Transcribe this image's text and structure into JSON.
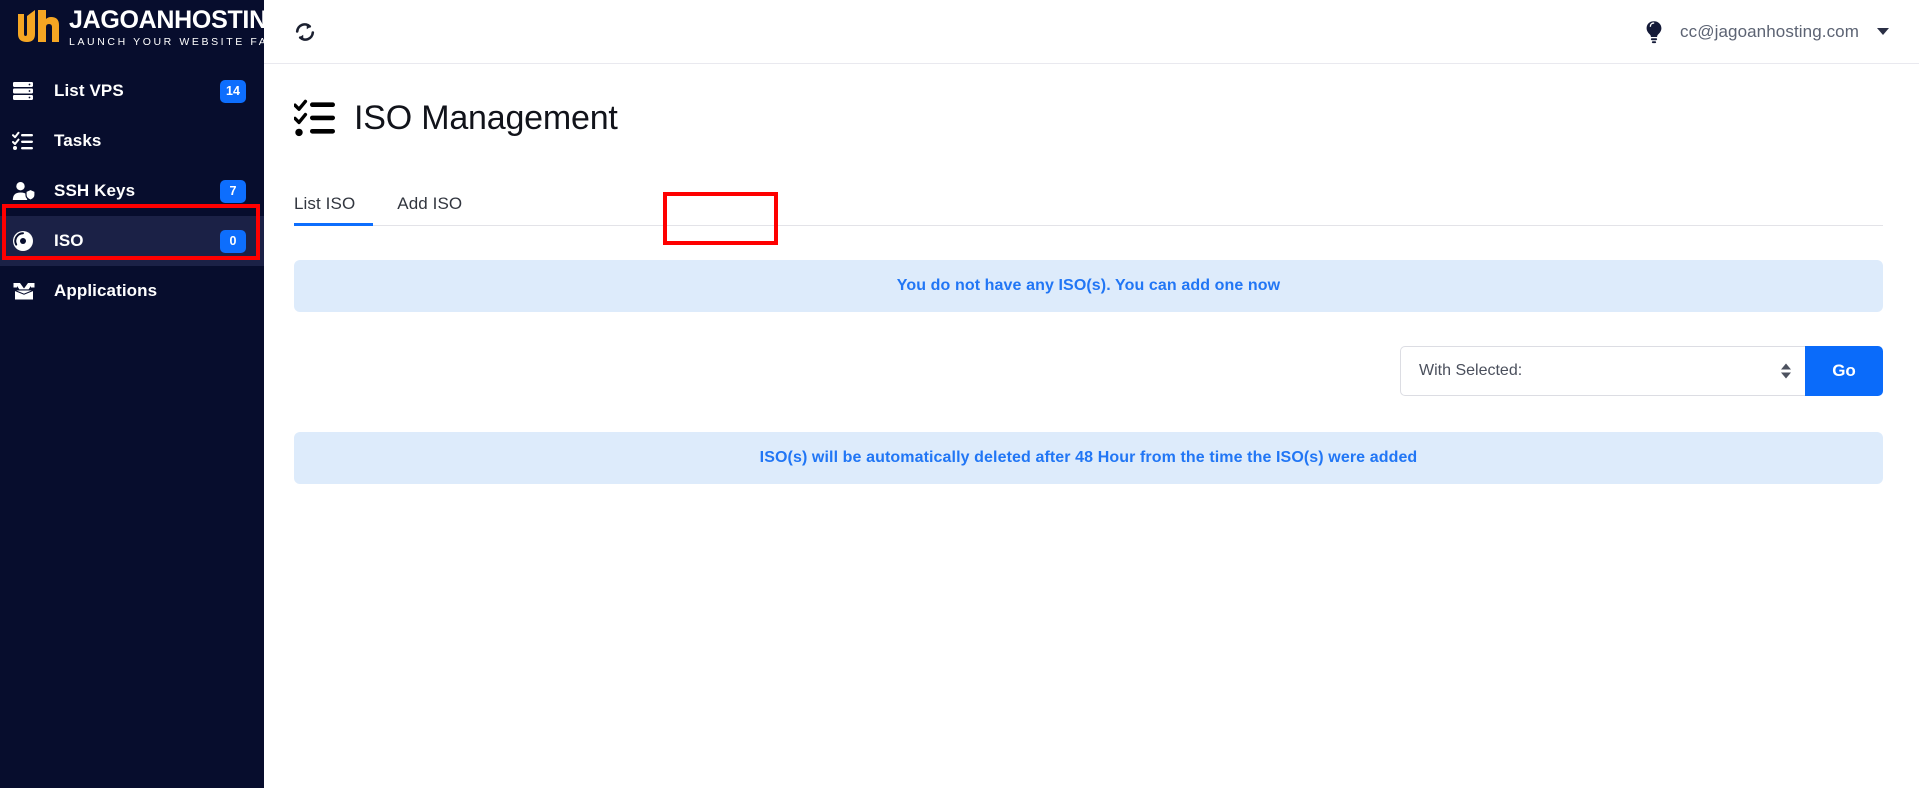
{
  "brand": {
    "name_bold": "JAGOAN",
    "name_light": "HOSTING",
    "tagline": "LAUNCH YOUR WEBSITE FAST",
    "accent_color": "#f5a623"
  },
  "sidebar": {
    "background_color": "#070d2d",
    "active_background_color": "#1b2146",
    "badge_color": "#0d6efd",
    "items": [
      {
        "label": "List VPS",
        "badge": "14",
        "icon": "server-icon",
        "active": false
      },
      {
        "label": "Tasks",
        "badge": "",
        "icon": "tasks-checklist-icon",
        "active": false
      },
      {
        "label": "SSH Keys",
        "badge": "7",
        "icon": "user-shield-icon",
        "active": false
      },
      {
        "label": "ISO",
        "badge": "0",
        "icon": "disc-icon",
        "active": true
      },
      {
        "label": "Applications",
        "badge": "",
        "icon": "open-box-icon",
        "active": false
      }
    ]
  },
  "topbar": {
    "refresh_icon": "refresh-icon",
    "bulb_icon": "lightbulb-icon",
    "user_email": "cc@jagoanhosting.com",
    "caret_icon": "chevron-down-icon"
  },
  "page": {
    "title": "ISO Management",
    "title_icon": "checklist-icon"
  },
  "tabs": [
    {
      "label": "List ISO",
      "active": true
    },
    {
      "label": "Add ISO",
      "active": false
    }
  ],
  "alerts": {
    "empty_state": "You do not have any ISO(s). You can add one now",
    "retention_notice": "ISO(s) will be automatically deleted after 48 Hour from the time the ISO(s) were added",
    "background_color": "#ddebfb",
    "text_color": "#2176f5"
  },
  "bulk_actions": {
    "select_value": "With Selected:",
    "select_options": [
      "With Selected:"
    ],
    "go_label": "Go",
    "go_color": "#0a6bfa"
  },
  "annotations": {
    "color": "#fe0000",
    "boxes": [
      "sidebar-item-iso",
      "tab-add-iso"
    ]
  }
}
